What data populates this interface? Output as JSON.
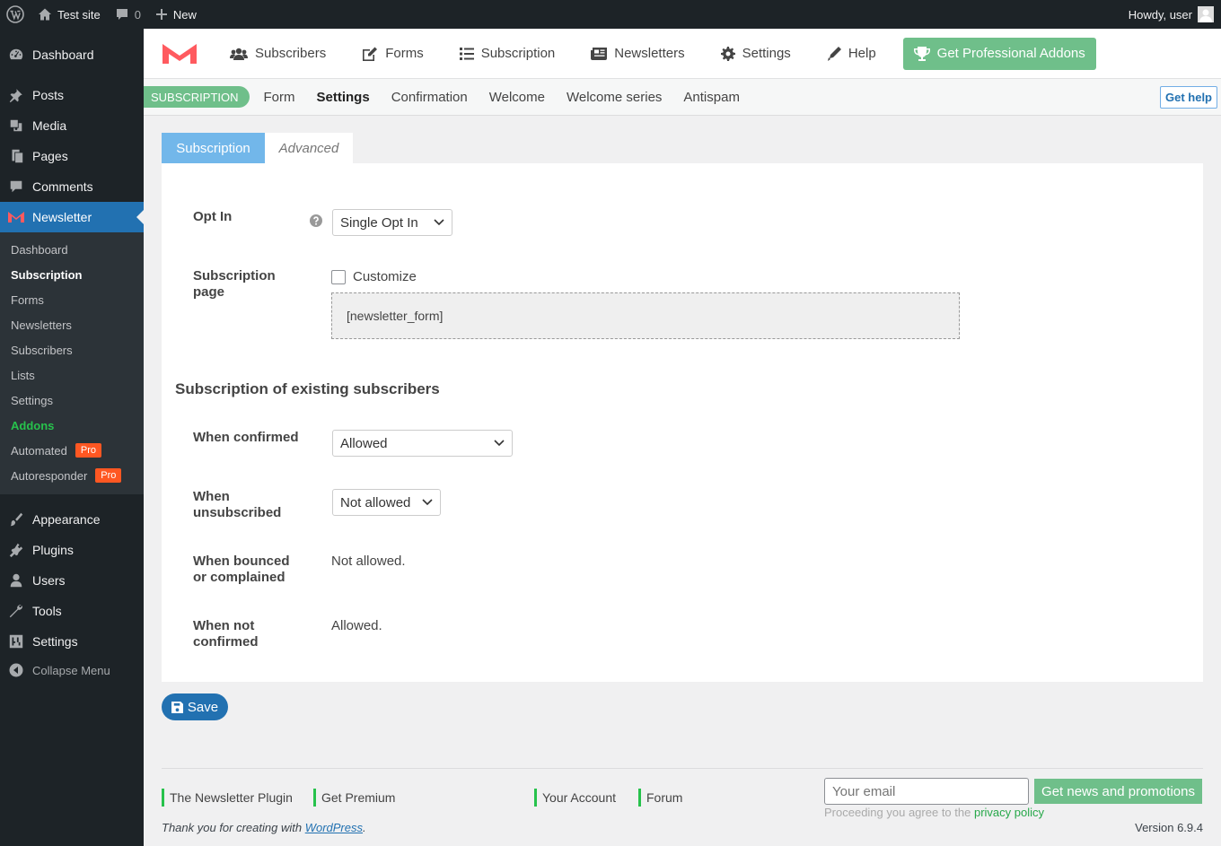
{
  "admin_bar": {
    "site_name": "Test site",
    "comments_count": "0",
    "new_label": "New",
    "greeting": "Howdy, user"
  },
  "sidebar": {
    "menu": [
      {
        "label": "Dashboard",
        "icon": "dashboard-icon"
      },
      {
        "label": "Posts",
        "icon": "pin-icon"
      },
      {
        "label": "Media",
        "icon": "media-icon"
      },
      {
        "label": "Pages",
        "icon": "pages-icon"
      },
      {
        "label": "Comments",
        "icon": "comment-icon"
      },
      {
        "label": "Newsletter",
        "icon": "newsletter-icon"
      },
      {
        "label": "Appearance",
        "icon": "brush-icon"
      },
      {
        "label": "Plugins",
        "icon": "plugin-icon"
      },
      {
        "label": "Users",
        "icon": "user-icon"
      },
      {
        "label": "Tools",
        "icon": "wrench-icon"
      },
      {
        "label": "Settings",
        "icon": "settings-icon"
      }
    ],
    "submenu": [
      {
        "label": "Dashboard"
      },
      {
        "label": "Subscription"
      },
      {
        "label": "Forms"
      },
      {
        "label": "Newsletters"
      },
      {
        "label": "Subscribers"
      },
      {
        "label": "Lists"
      },
      {
        "label": "Settings"
      },
      {
        "label": "Addons"
      },
      {
        "label": "Automated",
        "badge": "Pro"
      },
      {
        "label": "Autoresponder",
        "badge": "Pro"
      }
    ],
    "collapse_label": "Collapse Menu"
  },
  "plugin_nav": {
    "items": [
      {
        "label": "Subscribers",
        "icon": "users-icon"
      },
      {
        "label": "Forms",
        "icon": "edit-icon"
      },
      {
        "label": "Subscription",
        "icon": "list-icon"
      },
      {
        "label": "Newsletters",
        "icon": "newspaper-icon"
      },
      {
        "label": "Settings",
        "icon": "cog-icon"
      },
      {
        "label": "Help",
        "icon": "pen-icon"
      }
    ],
    "cta_label": "Get Professional Addons",
    "brand_color": "#6fbf8a",
    "accent_color": "#2271b1"
  },
  "subnav": {
    "badge": "Subscription",
    "items": [
      "Form",
      "Settings",
      "Confirmation",
      "Welcome",
      "Welcome series",
      "Antispam"
    ],
    "help_label": "Get help"
  },
  "tabs": [
    "Subscription",
    "Advanced"
  ],
  "form": {
    "opt_in": {
      "label": "Opt In",
      "value": "Single Opt In"
    },
    "subscription_page": {
      "label": "Subscription page",
      "checkbox_label": "Customize",
      "shortcode": "[newsletter_form]"
    },
    "section_title": "Subscription of existing subscribers",
    "when_confirmed": {
      "label": "When confirmed",
      "value": "Allowed"
    },
    "when_unsubscribed": {
      "label": "When unsubscribed",
      "value": "Not allowed"
    },
    "when_bounced": {
      "label": "When bounced or complained",
      "value": "Not allowed."
    },
    "when_not_confirmed": {
      "label": "When not confirmed",
      "value": "Allowed."
    },
    "save_label": "Save"
  },
  "footer": {
    "links": [
      "The Newsletter Plugin",
      "Get Premium",
      "Your Account",
      "Forum"
    ],
    "email_placeholder": "Your email",
    "news_button": "Get news and promotions",
    "privacy_prefix": "Proceeding you agree to the",
    "privacy_link": "privacy policy",
    "thanks_prefix": "Thank you for creating with",
    "thanks_link": "WordPress",
    "thanks_suffix": ".",
    "version": "Version 6.9.4"
  }
}
